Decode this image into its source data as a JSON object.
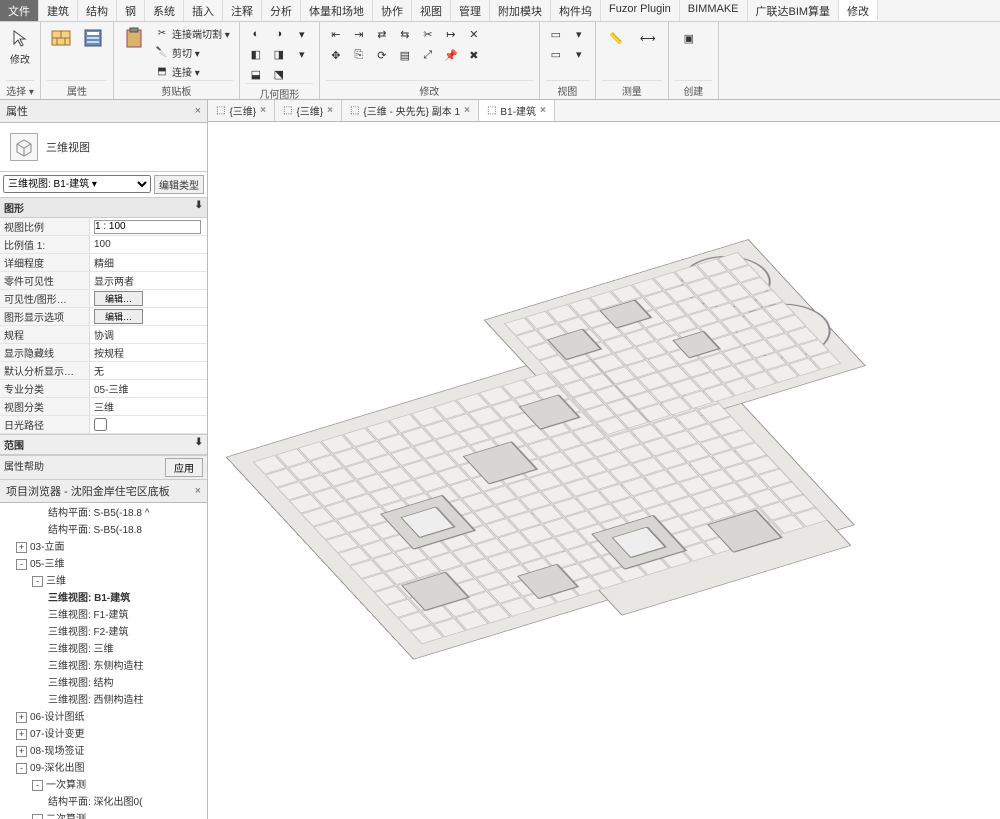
{
  "ribbon": {
    "tabs": [
      "文件",
      "建筑",
      "结构",
      "钢",
      "系统",
      "插入",
      "注释",
      "分析",
      "体量和场地",
      "协作",
      "视图",
      "管理",
      "附加模块",
      "构件坞",
      "Fuzor Plugin",
      "BIMMAKE",
      "广联达BIM算量",
      "修改"
    ],
    "active_tab": "修改",
    "groups": {
      "select": {
        "label": "选择 ▾",
        "btn": "修改"
      },
      "properties": {
        "label": "属性"
      },
      "clipboard": {
        "label": "剪贴板",
        "items": [
          "连接端切割 ▾",
          "剪切 ▾",
          "连接 ▾"
        ]
      },
      "geometry": {
        "label": "几何图形"
      },
      "modify": {
        "label": "修改"
      },
      "view": {
        "label": "视图"
      },
      "measure": {
        "label": "测量"
      },
      "create": {
        "label": "创建"
      }
    }
  },
  "view_tabs": [
    {
      "label": "{三维}",
      "close": true
    },
    {
      "label": "{三维}",
      "close": true
    },
    {
      "label": "{三维 - 央先先} 副本 1",
      "close": true
    },
    {
      "label": "B1-建筑",
      "close": true,
      "active": true
    }
  ],
  "properties_panel": {
    "title": "属性",
    "type_name": "三维视图",
    "filter_value": "三维视图: B1-建筑 ▾",
    "edit_type": "编辑类型",
    "section_graphics": "图形",
    "rows": [
      {
        "k": "视图比例",
        "v": "1 : 100",
        "type": "text"
      },
      {
        "k": "比例值 1:",
        "v": "100",
        "type": "plain"
      },
      {
        "k": "详细程度",
        "v": "精细",
        "type": "plain"
      },
      {
        "k": "零件可见性",
        "v": "显示两者",
        "type": "plain"
      },
      {
        "k": "可见性/图形…",
        "v": "编辑…",
        "type": "btn"
      },
      {
        "k": "图形显示选项",
        "v": "编辑…",
        "type": "btn"
      },
      {
        "k": "规程",
        "v": "协调",
        "type": "plain"
      },
      {
        "k": "显示隐藏线",
        "v": "按规程",
        "type": "plain"
      },
      {
        "k": "默认分析显示…",
        "v": "无",
        "type": "plain"
      },
      {
        "k": "专业分类",
        "v": "05-三维",
        "type": "plain"
      },
      {
        "k": "视图分类",
        "v": "三维",
        "type": "plain"
      },
      {
        "k": "日光路径",
        "v": "",
        "type": "check"
      }
    ],
    "extent_section": "范围",
    "help_label": "属性帮助",
    "apply_label": "应用"
  },
  "browser": {
    "title": "项目浏览器 - 沈阳金岸住宅区底板",
    "items": [
      {
        "level": 3,
        "label": "结构平面: S-B5(-18.8 ^"
      },
      {
        "level": 3,
        "label": "结构平面: S-B5(-18.8"
      },
      {
        "level": 1,
        "label": "03-立面",
        "toggle": "+"
      },
      {
        "level": 1,
        "label": "05-三维",
        "toggle": "-"
      },
      {
        "level": 2,
        "label": "三维",
        "toggle": "-"
      },
      {
        "level": 3,
        "label": "三维视图: B1-建筑",
        "active": true
      },
      {
        "level": 3,
        "label": "三维视图: F1-建筑"
      },
      {
        "level": 3,
        "label": "三维视图: F2-建筑"
      },
      {
        "level": 3,
        "label": "三维视图: 三维"
      },
      {
        "level": 3,
        "label": "三维视图: 东侧构造柱"
      },
      {
        "level": 3,
        "label": "三维视图: 结构"
      },
      {
        "level": 3,
        "label": "三维视图: 西侧构造柱"
      },
      {
        "level": 1,
        "label": "06-设计图纸",
        "toggle": "+"
      },
      {
        "level": 1,
        "label": "07-设计变更",
        "toggle": "+"
      },
      {
        "level": 1,
        "label": "08-现场签证",
        "toggle": "+"
      },
      {
        "level": 1,
        "label": "09-深化出图",
        "toggle": "-"
      },
      {
        "level": 2,
        "label": "一次算测",
        "toggle": "-"
      },
      {
        "level": 3,
        "label": "结构平面: 深化出图0("
      },
      {
        "level": 2,
        "label": "二次算测",
        "toggle": "-"
      }
    ]
  }
}
